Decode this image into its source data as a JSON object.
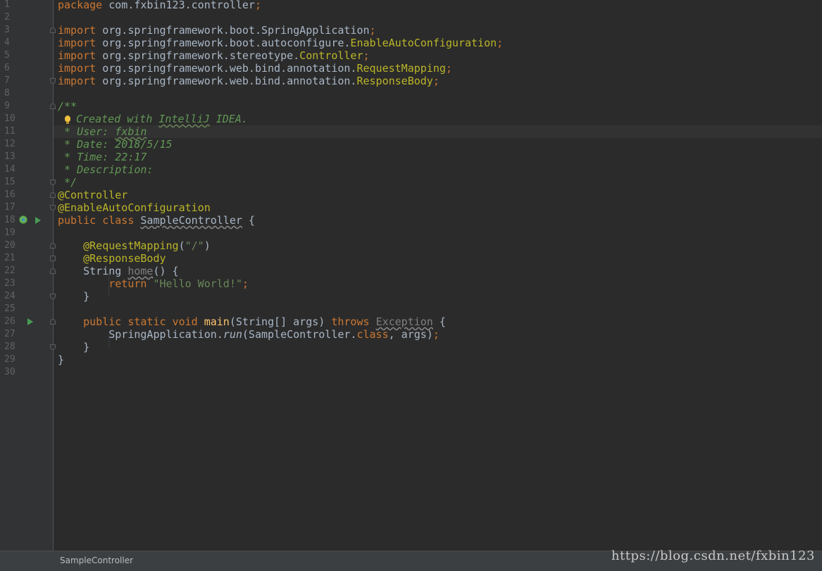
{
  "editor": {
    "line_numbers": [
      "1",
      "2",
      "3",
      "4",
      "5",
      "6",
      "7",
      "8",
      "9",
      "10",
      "11",
      "12",
      "13",
      "14",
      "15",
      "16",
      "17",
      "18",
      "19",
      "20",
      "21",
      "22",
      "23",
      "24",
      "25",
      "26",
      "27",
      "28",
      "29",
      "30"
    ],
    "lines": {
      "l1": {
        "kw": "package",
        "rest": " com.fxbin123.controller",
        "semi": ";"
      },
      "l3": {
        "kw": "import",
        "pkg": " org.springframework.boot.",
        "cls": "SpringApplication",
        "semi": ";"
      },
      "l4": {
        "kw": "import",
        "pkg": " org.springframework.boot.autoconfigure.",
        "cls": "EnableAutoConfiguration",
        "semi": ";"
      },
      "l5": {
        "kw": "import",
        "pkg": " org.springframework.stereotype.",
        "cls": "Controller",
        "semi": ";"
      },
      "l6": {
        "kw": "import",
        "pkg": " org.springframework.web.bind.annotation.",
        "cls": "RequestMapping",
        "semi": ";"
      },
      "l7": {
        "kw": "import",
        "pkg": " org.springframework.web.bind.annotation.",
        "cls": "ResponseBody",
        "semi": ";"
      },
      "l9": {
        "doc": "/**"
      },
      "l10": {
        "doc_a": "Created with ",
        "doc_b": "IntelliJ",
        "doc_c": " IDEA."
      },
      "l11": {
        "doc_a": " * User: ",
        "doc_b": "fxbin"
      },
      "l12": {
        "doc": " * Date: 2018/5/15"
      },
      "l13": {
        "doc": " * Time: 22:17"
      },
      "l14": {
        "doc": " * Description:"
      },
      "l15": {
        "doc": " */"
      },
      "l16": {
        "ann": "@Controller"
      },
      "l17": {
        "ann": "@EnableAutoConfiguration"
      },
      "l18": {
        "kw": "public class",
        "sp": " ",
        "name": "SampleController",
        "rest": " {"
      },
      "l20": {
        "indent": "    ",
        "ann": "@RequestMapping",
        "p1": "(",
        "str": "\"/\"",
        "p2": ")"
      },
      "l21": {
        "indent": "    ",
        "ann": "@ResponseBody"
      },
      "l22": {
        "indent": "    ",
        "type": "String ",
        "name": "home",
        "rest": "() {"
      },
      "l23": {
        "indent": "        ",
        "kw": "return ",
        "str": "\"Hello World!\"",
        "semi": ";"
      },
      "l24": {
        "text": "    }"
      },
      "l26": {
        "indent": "    ",
        "kw": "public static void ",
        "fn": "main",
        "rest": "(String[] args) ",
        "kw2": "throws ",
        "exc": "Exception",
        "end": " {"
      },
      "l27": {
        "indent": "        ",
        "a": "SpringApplication.",
        "run": "run",
        "b": "(SampleController.",
        "cls": "class",
        "c": ", args)",
        "semi": ";"
      },
      "l28": {
        "text": "    }"
      },
      "l29": {
        "text": "}"
      }
    }
  },
  "status": {
    "breadcrumb": "SampleController",
    "watermark": "https://blog.csdn.net/fxbin123"
  },
  "icons": {
    "run": "run-gutter-icon",
    "spring": "spring-bean-icon",
    "intention": "intention-bulb-icon"
  },
  "colors": {
    "background": "#2b2b2b",
    "gutter": "#313335",
    "keyword": "#cc7832",
    "annotation": "#bbb529",
    "string": "#6a8759",
    "doc_comment": "#629755",
    "function": "#ffc66d",
    "text": "#a9b7c6"
  }
}
